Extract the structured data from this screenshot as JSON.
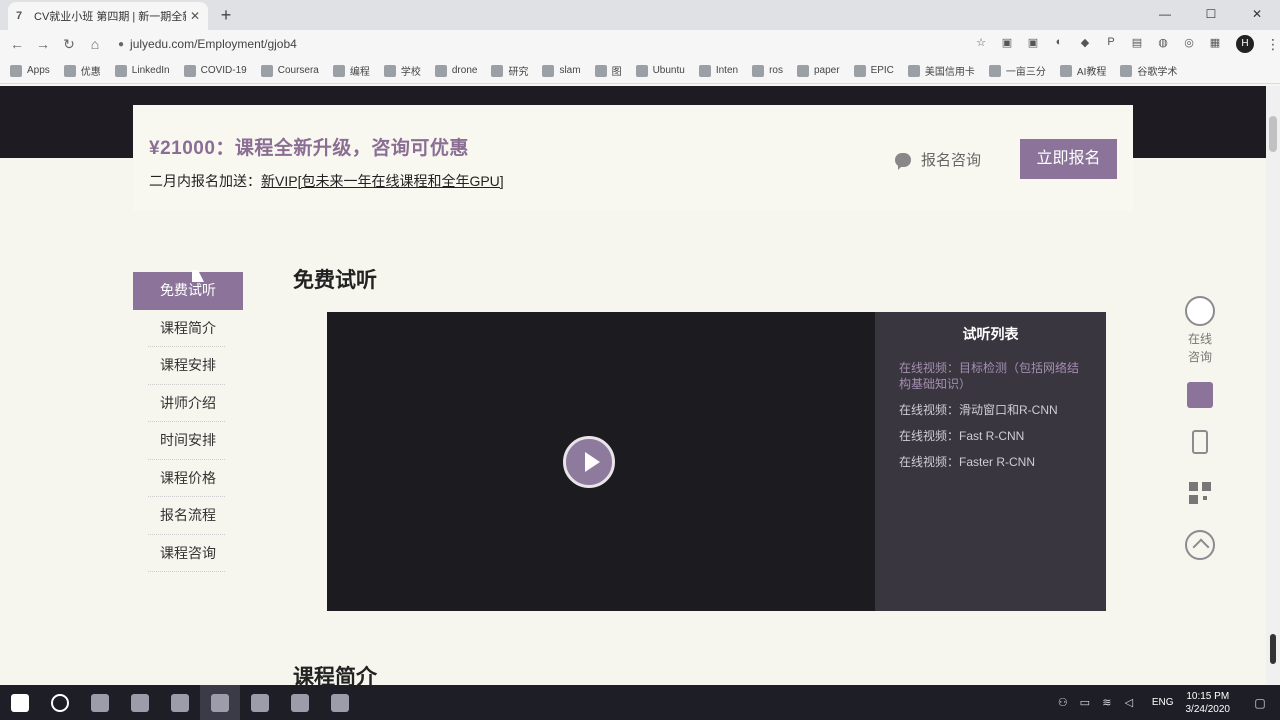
{
  "browser": {
    "tab_title": "CV就业小班 第四期 | 新一期全新",
    "tab_icon": "7",
    "url": "julyedu.com/Employment/gjob4",
    "bookmarks": [
      "Apps",
      "优惠",
      "LinkedIn",
      "COVID-19",
      "Coursera",
      "编程",
      "学校",
      "drone",
      "研究",
      "slam",
      "图",
      "Ubuntu",
      "Inten",
      "ros",
      "paper",
      "EPIC",
      "美国信用卡",
      "一亩三分",
      "AI教程",
      "谷歌学术"
    ],
    "avatar_letter": "H"
  },
  "promo": {
    "title": "¥21000：课程全新升级，咨询可优惠",
    "sub_prefix": "二月内报名加送：",
    "sub_link": "新VIP[包未来一年在线课程和全年GPU]",
    "consult_label": "报名咨询",
    "signup_label": "立即报名"
  },
  "sidenav": {
    "items": [
      "免费试听",
      "课程简介",
      "课程安排",
      "讲师介绍",
      "时间安排",
      "课程价格",
      "报名流程",
      "课程咨询"
    ],
    "active_index": 0
  },
  "section_title": "免费试听",
  "next_section_title": "课程简介",
  "playlist": {
    "title": "试听列表",
    "items": [
      "在线视频：目标检测（包括网络结构基础知识）",
      "在线视频：滑动窗口和R-CNN",
      "在线视频：Fast R-CNN",
      "在线视频：Faster R-CNN"
    ]
  },
  "float_tools": {
    "consult_line1": "在线",
    "consult_line2": "咨询"
  },
  "taskbar": {
    "lang": "ENG",
    "time": "10:15 PM",
    "date": "3/24/2020"
  },
  "colors": {
    "accent": "#8b7399",
    "dark": "#1e1b22",
    "page_bg": "#f6f6ee"
  }
}
